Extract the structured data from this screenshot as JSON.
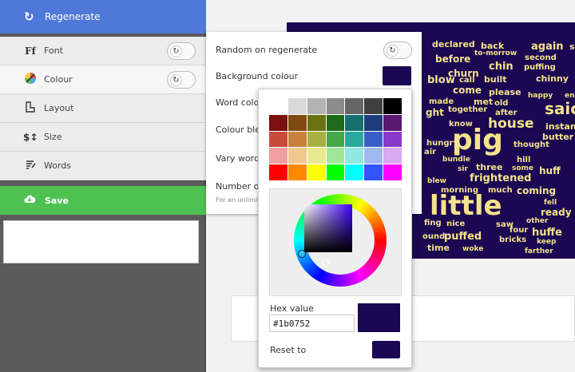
{
  "sidebar": {
    "regenerate": {
      "label": "Regenerate",
      "icon": "refresh-icon"
    },
    "items": [
      {
        "id": "font",
        "label": "Font",
        "icon": "font-icon"
      },
      {
        "id": "colour",
        "label": "Colour",
        "icon": "palette-icon"
      },
      {
        "id": "layout",
        "label": "Layout",
        "icon": "layout-icon"
      },
      {
        "id": "size",
        "label": "Size",
        "icon": "size-icon"
      },
      {
        "id": "words",
        "label": "Words",
        "icon": "words-icon"
      }
    ],
    "save": {
      "label": "Save",
      "icon": "cloud-download-icon"
    }
  },
  "colour_panel": {
    "random_on_regenerate": "Random on regenerate",
    "background_colour": "Background colour",
    "word_colour": "Word colou",
    "colour_blend": "Colour blen",
    "vary_word": "Vary word c",
    "number_of": "Number of",
    "hint": "For an unlimit"
  },
  "picker": {
    "hex_label": "Hex value",
    "hex_value": "#1b0752",
    "reset_label": "Reset to",
    "current_color": "#1b0752",
    "palette": [
      [
        "#ffffff",
        "#d9d9d9",
        "#b3b3b3",
        "#8c8c8c",
        "#666666",
        "#404040",
        "#000000"
      ],
      [
        "#7b1010",
        "#7f4a10",
        "#6b7212",
        "#1f6b1a",
        "#157070",
        "#1f3d7a",
        "#5a1870"
      ],
      [
        "#c84a3a",
        "#c8803a",
        "#a8b040",
        "#44a848",
        "#2aa8a0",
        "#3a5ec8",
        "#8a3ac8"
      ],
      [
        "#f0a0a0",
        "#f0c890",
        "#e8e890",
        "#a0e898",
        "#90e8e0",
        "#a0b8f0",
        "#d8a8f0"
      ],
      [
        "#ff0000",
        "#ff8800",
        "#ffff00",
        "#00ff00",
        "#00ffff",
        "#3355ff",
        "#ff00ff"
      ]
    ]
  },
  "cloud_words": [
    "declared",
    "back",
    "again",
    "se",
    "to-morrow",
    "second",
    "before",
    "chin",
    "puffing",
    "churn",
    "blow",
    "call",
    "built",
    "chinny",
    "come",
    "please",
    "happy",
    "en",
    "made",
    "met",
    "old",
    "together",
    "saic",
    "ght",
    "after",
    "know",
    "house",
    "instan",
    "butter",
    "pig",
    "thought",
    "hungry",
    "bundle",
    "hill",
    "some",
    "huff",
    "air",
    "three",
    "sir",
    "frightened",
    "blew",
    "morning",
    "much",
    "coming",
    "fell",
    "little",
    "ready",
    "other",
    "fing",
    "nice",
    "saw",
    "four",
    "huffe",
    "ound",
    "puffed",
    "bricks",
    "keep",
    "time",
    "woke",
    "farther"
  ]
}
